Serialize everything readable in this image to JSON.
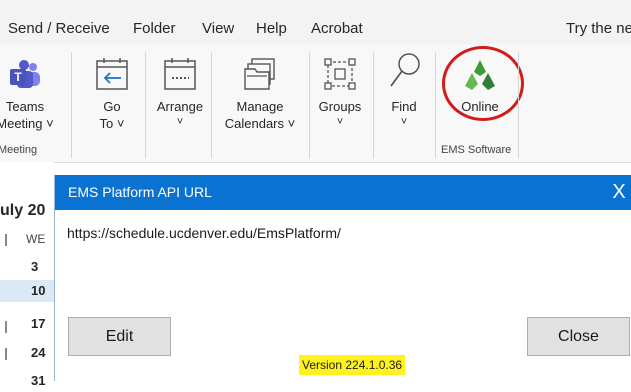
{
  "menu": {
    "tabs": [
      "Send / Receive",
      "Folder",
      "View",
      "Help",
      "Acrobat"
    ],
    "right_text": "Try the ne"
  },
  "ribbon": {
    "teams": {
      "line1": "Teams",
      "line2": "Meeting",
      "chev": "˅"
    },
    "go_to": {
      "line1": "Go",
      "line2": "To",
      "chev": "˅"
    },
    "arrange": {
      "line1": "Arrange",
      "chev": "˅"
    },
    "manage_calendars": {
      "line1": "Manage",
      "line2": "Calendars",
      "chev": "˅"
    },
    "groups": {
      "line1": "Groups",
      "chev": "˅"
    },
    "find": {
      "line1": "Find",
      "chev": "˅"
    },
    "online": {
      "label": "Online"
    },
    "group_labels": {
      "meeting": "Meeting",
      "ems": "EMS Software"
    }
  },
  "calendar": {
    "month": "uly 20",
    "weekday": "WE",
    "days": [
      "3",
      "10",
      "17",
      "24",
      "31"
    ],
    "selected_day": "10"
  },
  "dialog": {
    "title": "EMS Platform API URL",
    "close_glyph": "X",
    "url": "https://schedule.ucdenver.edu/EmsPlatform/",
    "edit_label": "Edit",
    "close_label": "Close",
    "version": "Version 224.1.0.36"
  },
  "colors": {
    "title_bar": "#0a73d1",
    "highlight": "#fff21f",
    "oval": "#d21b1b",
    "selected_day": "#dbe8f6",
    "ems_logo": "#4caa3b"
  },
  "icons": [
    "teams-icon",
    "go-to-icon",
    "arrange-icon",
    "manage-calendars-icon",
    "groups-icon",
    "find-icon",
    "ems-online-icon"
  ]
}
